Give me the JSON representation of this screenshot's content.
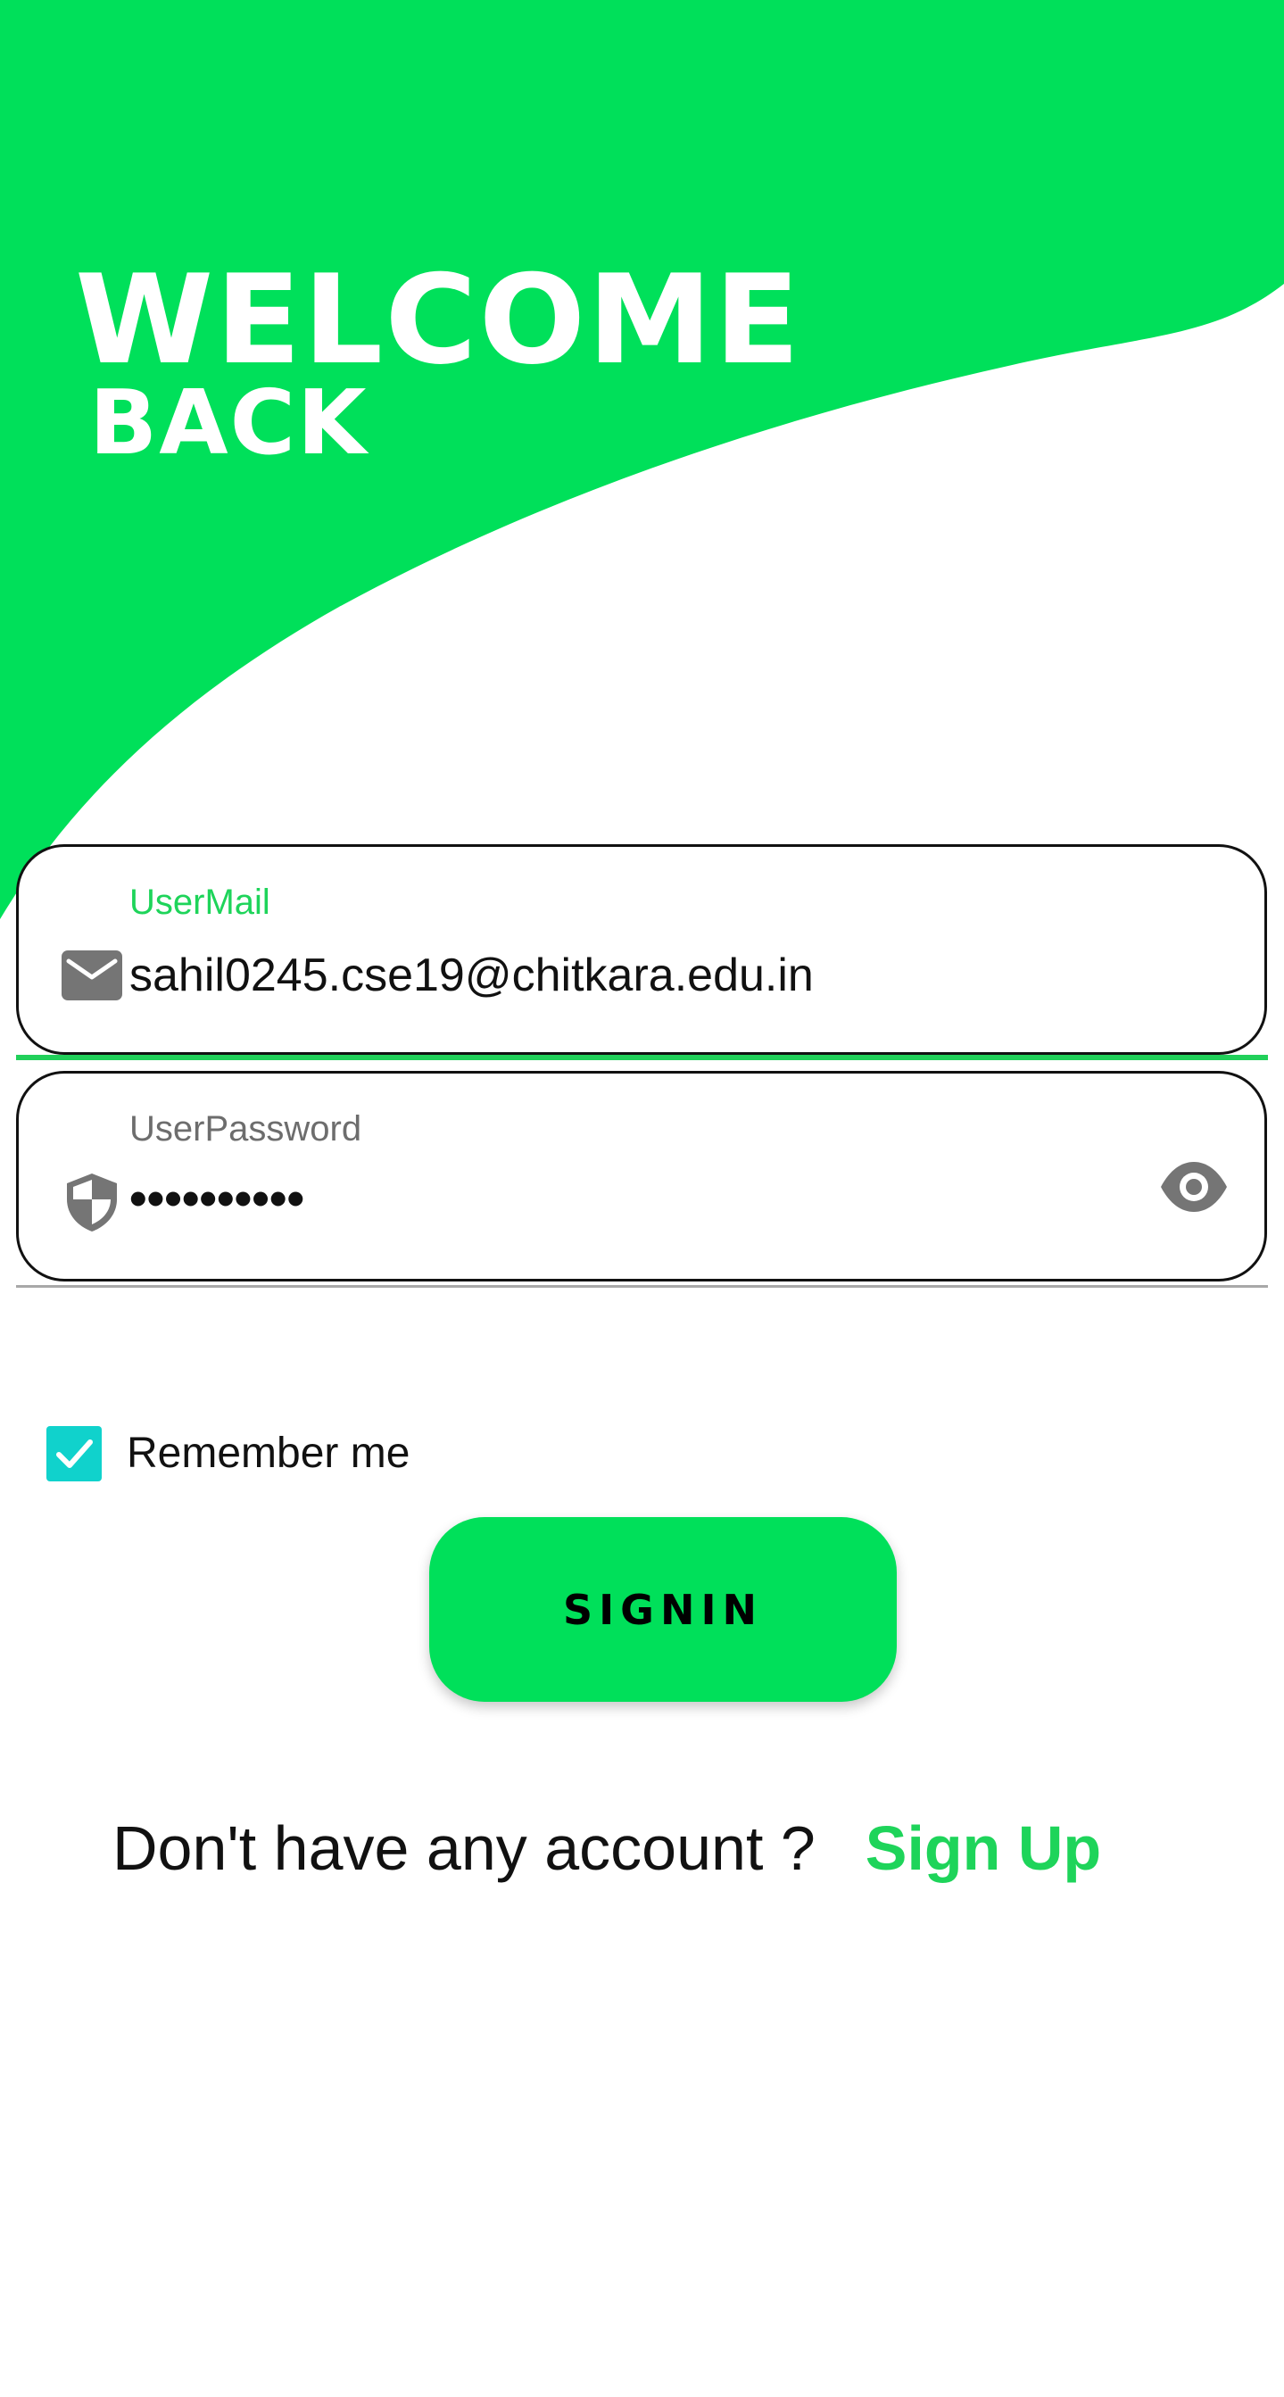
{
  "hero": {
    "title_line1": "WELCOME",
    "title_line2": "BACK"
  },
  "email_field": {
    "label": "UserMail",
    "value": "sahil0245.cse19@chitkara.edu.in",
    "icon": "email-icon"
  },
  "password_field": {
    "label": "UserPassword",
    "value_masked": "••••••••••",
    "icon": "shield-icon",
    "toggle_icon": "eye-icon"
  },
  "remember": {
    "label": "Remember me",
    "checked": true
  },
  "signin": {
    "label": "SIGNIN"
  },
  "footer": {
    "question": "Don't have any account ?",
    "signup_label": "Sign Up"
  },
  "colors": {
    "brand_green": "#00e05a",
    "accent_green_text": "#1ed45a",
    "checkbox_teal": "#10d2cc",
    "icon_gray": "#757575"
  }
}
